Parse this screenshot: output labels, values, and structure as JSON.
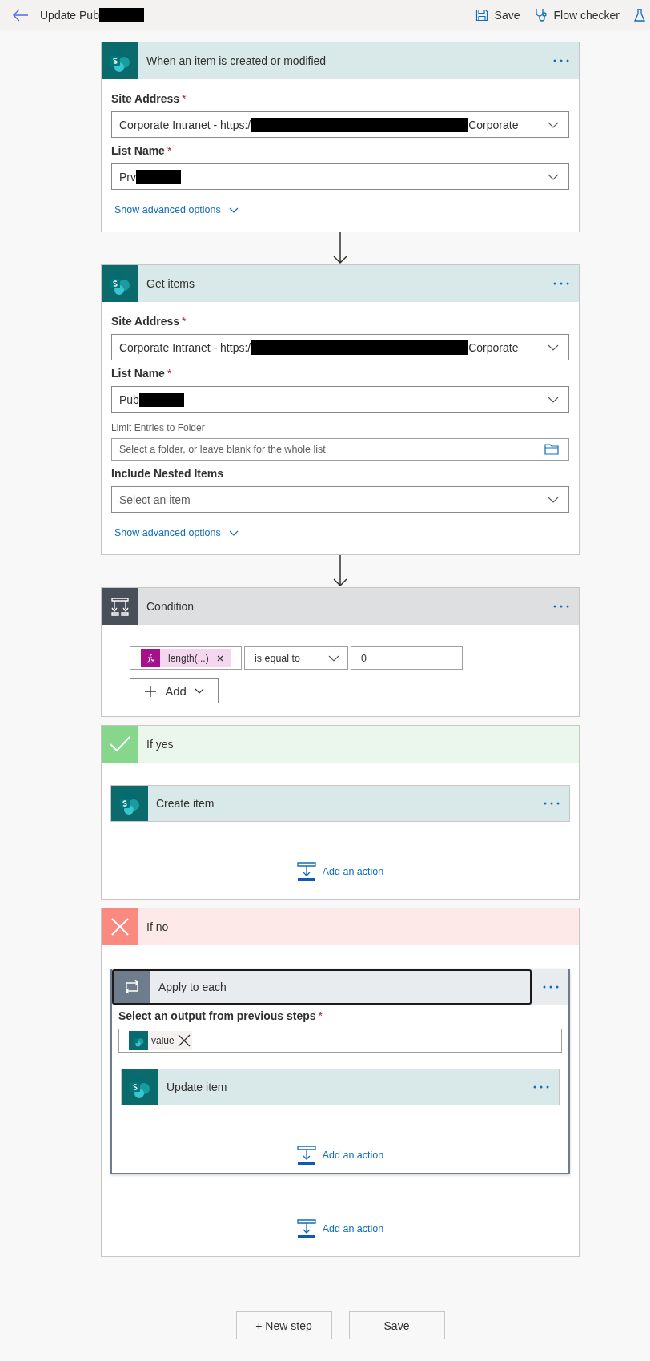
{
  "header": {
    "title": "Update Pub",
    "redacted": true,
    "actions": [
      {
        "kind": "save",
        "label": "Save"
      },
      {
        "kind": "checker",
        "label": "Flow checker"
      },
      {
        "kind": "test"
      }
    ]
  },
  "steps": [
    {
      "kind": "action",
      "title": "When an item is created or modified",
      "fields": [
        {
          "kind": "dropdown",
          "label": "Site Address",
          "required_mark": "*",
          "value": "Corporate Intranet - https:/",
          "redacted": true,
          "suffix": "Corporate"
        },
        {
          "kind": "dropdown",
          "label": "List Name",
          "required_mark": "*",
          "value": "Prv",
          "redacted": true
        }
      ],
      "advanced": "Show advanced options"
    },
    {
      "kind": "action",
      "title": "Get items",
      "fields": [
        {
          "kind": "dropdown",
          "label": "Site Address",
          "required_mark": "*",
          "value": "Corporate Intranet - https:/",
          "redacted": true,
          "suffix": "Corporate"
        },
        {
          "kind": "dropdown",
          "label": "List Name",
          "required_mark": "*",
          "value": "Pub",
          "redacted": true
        },
        {
          "kind": "folder",
          "label": "Limit Entries to Folder",
          "placeholder": "Select a folder, or leave blank for the whole list"
        },
        {
          "kind": "dropdown",
          "label": "Include Nested Items",
          "placeholder": "Select an item"
        }
      ],
      "advanced": "Show advanced options"
    },
    {
      "kind": "condition",
      "title": "Condition",
      "rows": [
        {
          "token": "length(...)",
          "operator": "is equal to",
          "value": "0"
        }
      ],
      "add": "Add"
    },
    {
      "kind": "branch",
      "positive": true,
      "title": "If yes",
      "actions": [
        {
          "kind": "action",
          "title": "Create item"
        }
      ],
      "add_action": "Add an action"
    },
    {
      "kind": "branch",
      "positive": false,
      "title": "If no",
      "actions": [
        {
          "kind": "loop",
          "title": "Apply to each",
          "selected": true,
          "field_label": "Select an output from previous steps",
          "required_mark": "*",
          "token": "value",
          "actions": [
            {
              "kind": "action",
              "title": "Update item"
            }
          ],
          "add_action": "Add an action"
        }
      ],
      "add_action": "Add an action"
    }
  ],
  "footer": [
    "+ New step",
    "Save"
  ]
}
